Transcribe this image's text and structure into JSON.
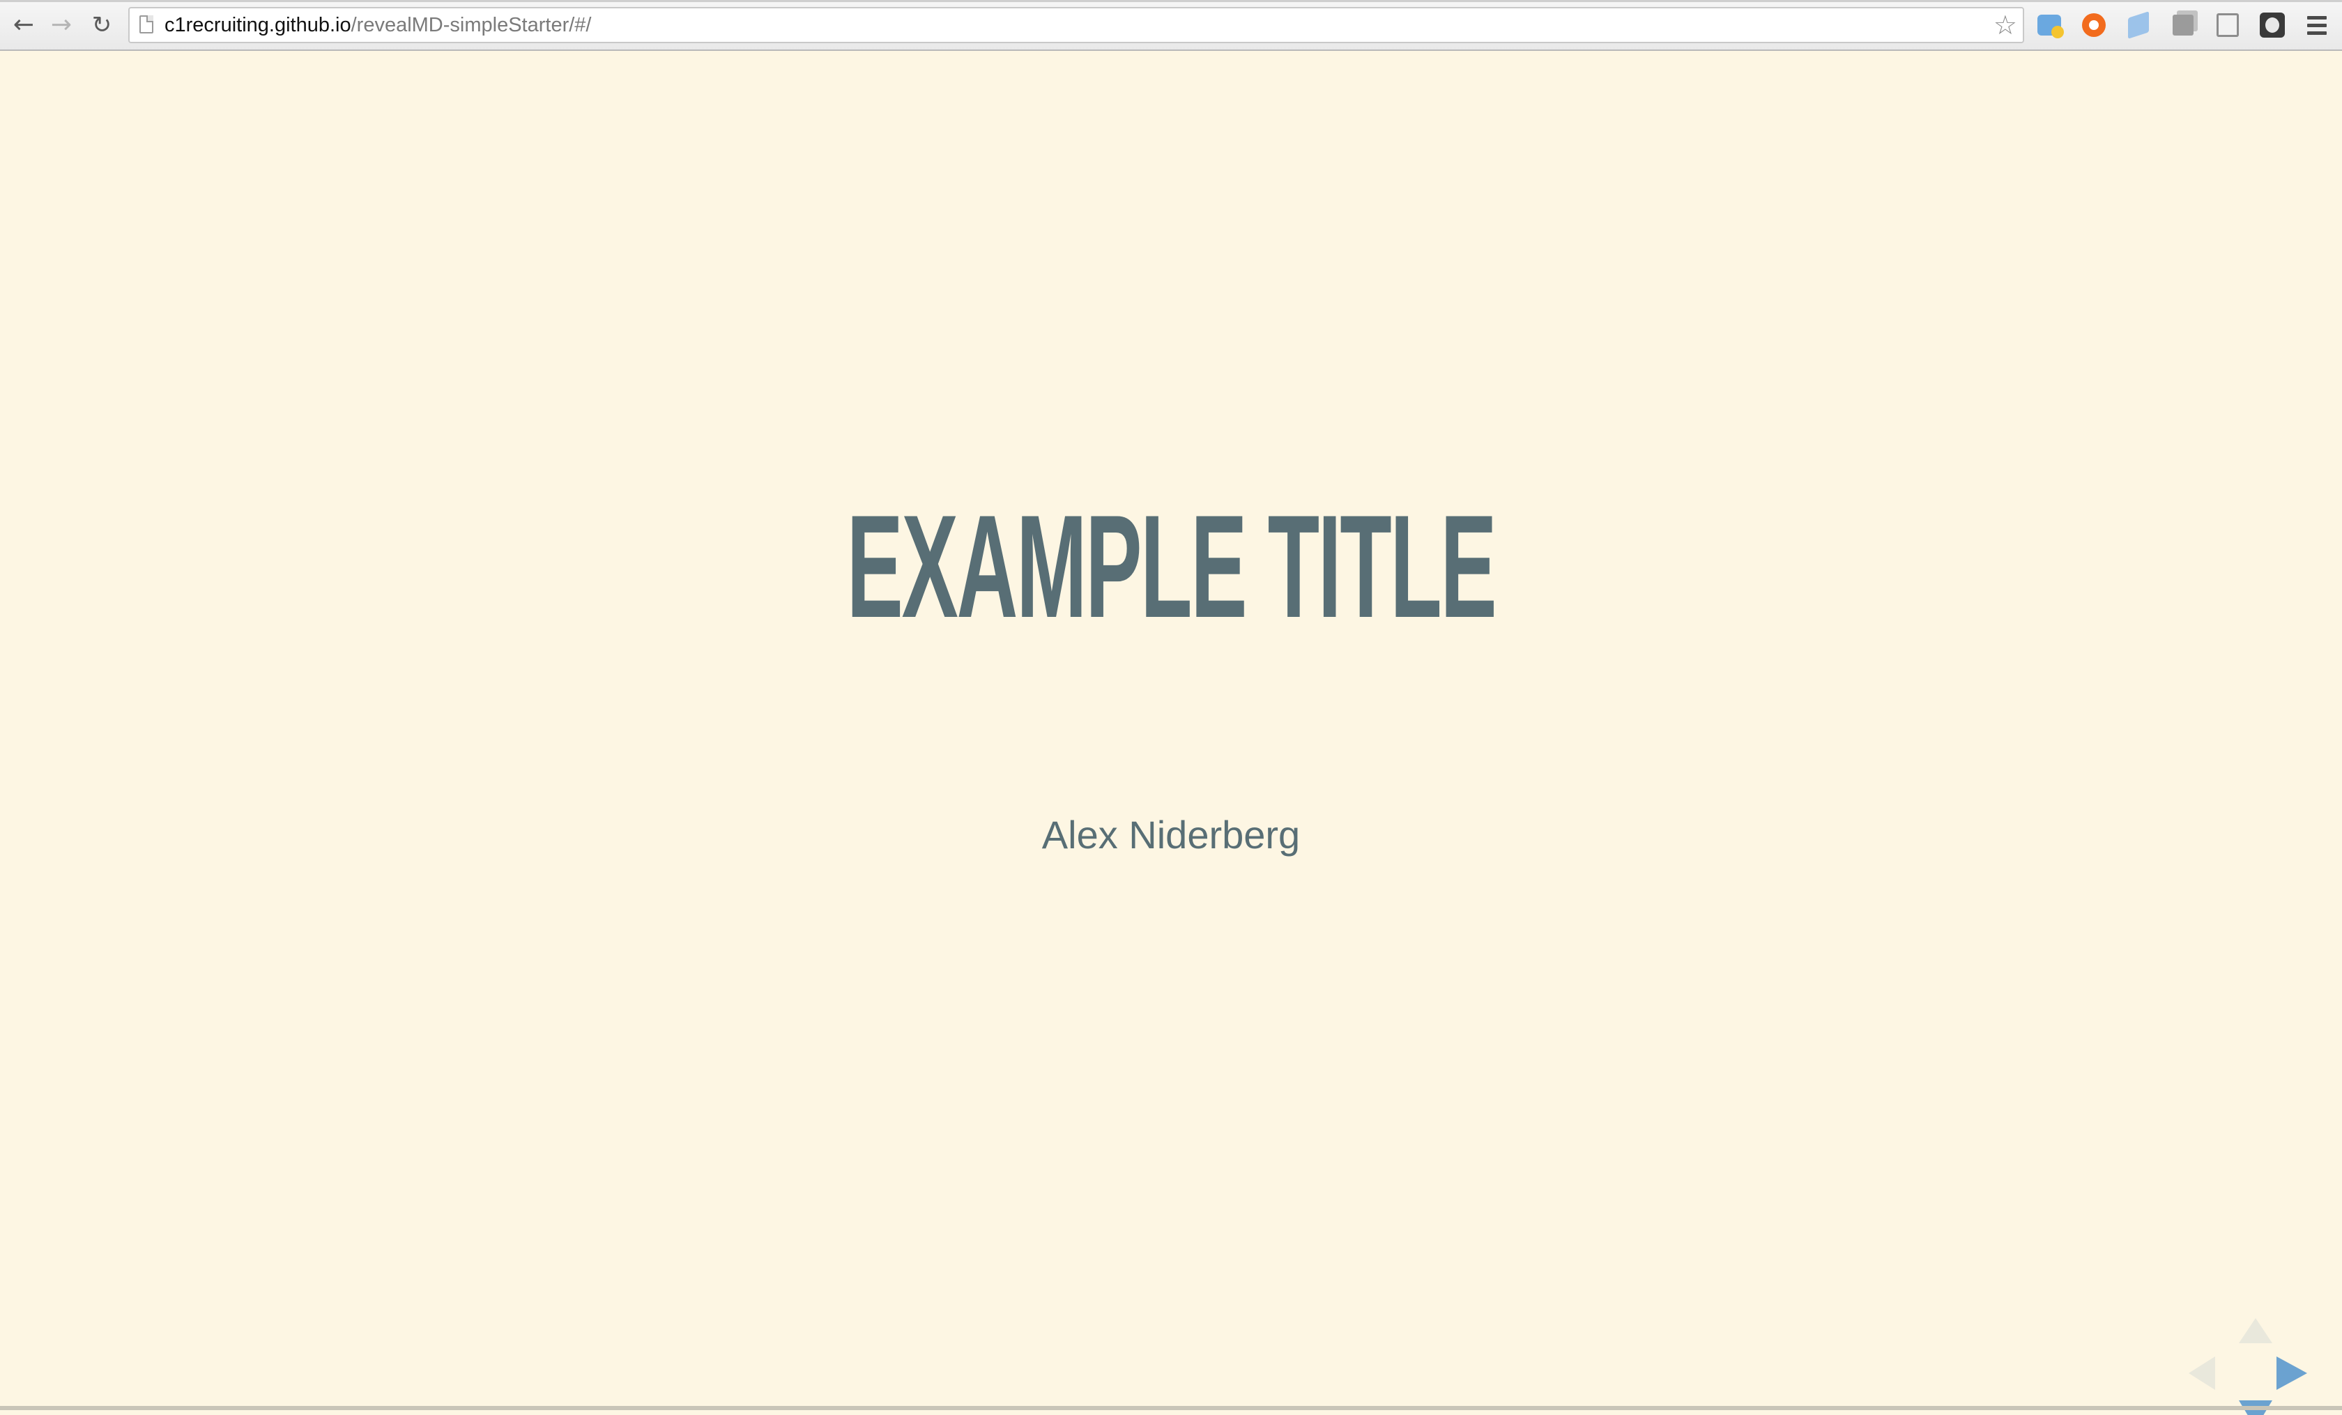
{
  "browser": {
    "url_host": "c1recruiting.github.io",
    "url_path": "/revealMD-simpleStarter/#/",
    "icons": {
      "back": "arrow-left-icon",
      "forward": "arrow-right-icon",
      "reload": "reload-icon",
      "bookmark": "star-icon",
      "menu": "hamburger-menu-icon"
    },
    "extensions": [
      "extension-1-icon",
      "extension-2-icon",
      "extension-3-icon",
      "extension-4-icon",
      "extension-5-icon",
      "extension-6-icon"
    ]
  },
  "slide": {
    "title": "EXAMPLE TITLE",
    "author": "Alex Niderberg"
  },
  "controls": {
    "up_enabled": false,
    "left_enabled": false,
    "right_enabled": true,
    "down_enabled": true
  },
  "colors": {
    "slide_background": "#fdf6e3",
    "text": "#586e75",
    "control_active": "#6ba2d0",
    "control_inactive": "#e9e8dc"
  }
}
